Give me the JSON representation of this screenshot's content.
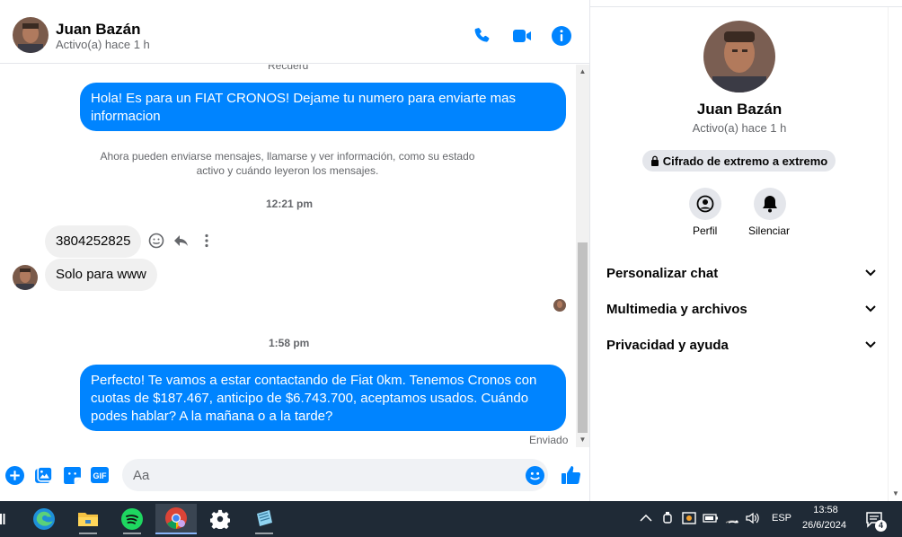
{
  "contact": {
    "name": "Juan Bazán",
    "status": "Activo(a) hace 1 h"
  },
  "header": {
    "call_icon": "phone-icon",
    "video_icon": "video-icon",
    "info_icon": "info-icon"
  },
  "messages": {
    "cut_text": "Recuerd",
    "out1": "Hola! Es para un FIAT CRONOS! Dejame tu numero para enviarte mas informacion",
    "system_note": "Ahora pueden enviarse mensajes, llamarse y ver información, como su estado activo y cuándo leyeron los mensajes.",
    "time1": "12:21 pm",
    "in1": "3804252825",
    "in2": "Solo para www",
    "time2": "1:58 pm",
    "out2": "Perfecto! Te vamos a estar contactando de Fiat 0km. Tenemos Cronos con cuotas de $187.467, anticipo de $6.743.700, aceptamos usados. Cuándo podes hablar? A la mañana o a la tarde?",
    "sent_label": "Enviado"
  },
  "composer": {
    "placeholder": "Aa"
  },
  "info_panel": {
    "name": "Juan Bazán",
    "status": "Activo(a) hace 1 h",
    "e2e_label": "Cifrado de extremo a extremo",
    "profile_label": "Perfil",
    "mute_label": "Silenciar",
    "rows": [
      "Personalizar chat",
      "Multimedia y archivos",
      "Privacidad y ayuda"
    ]
  },
  "taskbar": {
    "language": "ESP",
    "time": "13:58",
    "date": "26/6/2024",
    "notification_count": "4"
  },
  "colors": {
    "accent": "#0084ff",
    "taskbar": "#1f2a36"
  }
}
